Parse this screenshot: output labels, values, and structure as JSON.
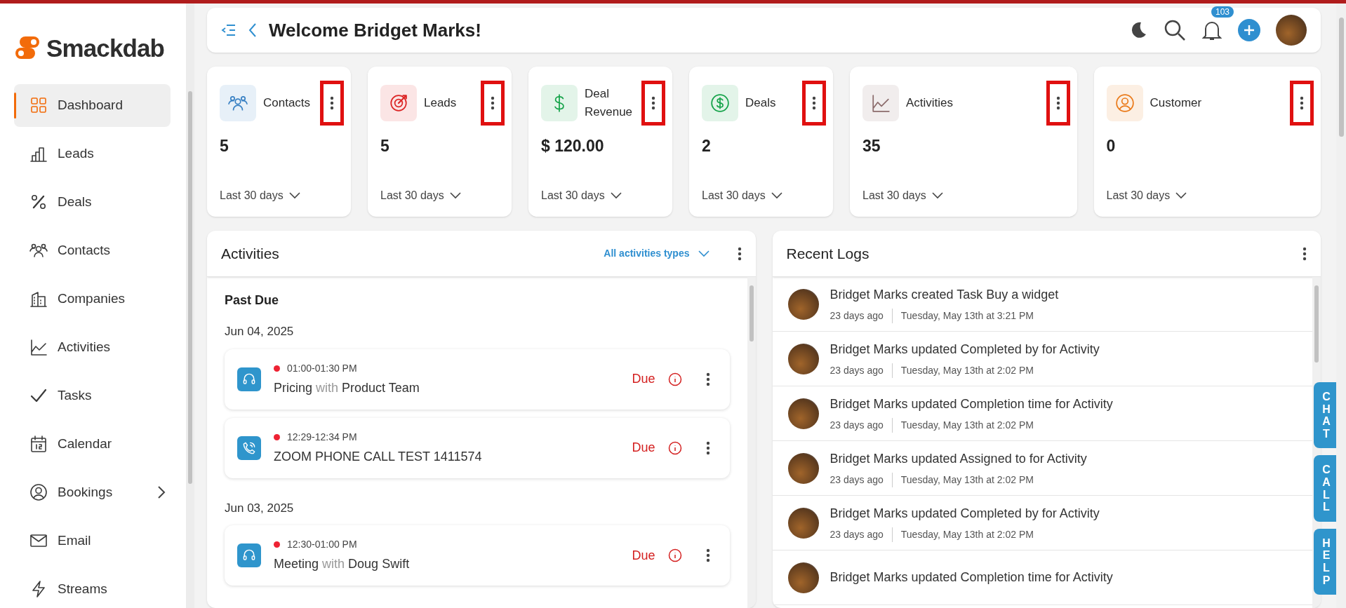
{
  "brand": {
    "name": "Smackdab"
  },
  "sidebar": {
    "items": [
      {
        "label": "Dashboard",
        "selected": true,
        "submenu": false
      },
      {
        "label": "Leads",
        "selected": false,
        "submenu": false
      },
      {
        "label": "Deals",
        "selected": false,
        "submenu": false
      },
      {
        "label": "Contacts",
        "selected": false,
        "submenu": false
      },
      {
        "label": "Companies",
        "selected": false,
        "submenu": false
      },
      {
        "label": "Activities",
        "selected": false,
        "submenu": false
      },
      {
        "label": "Tasks",
        "selected": false,
        "submenu": false
      },
      {
        "label": "Calendar",
        "selected": false,
        "submenu": false
      },
      {
        "label": "Bookings",
        "selected": false,
        "submenu": true
      },
      {
        "label": "Email",
        "selected": false,
        "submenu": false
      },
      {
        "label": "Streams",
        "selected": false,
        "submenu": false
      }
    ]
  },
  "header": {
    "title": "Welcome Bridget Marks!",
    "notifications": "103"
  },
  "stats": [
    {
      "color": "#3b82c4",
      "label": "Contacts",
      "value": "5",
      "period": "Last 30 days",
      "highlighted": true
    },
    {
      "color": "#dc2626",
      "label": "Leads",
      "value": "5",
      "period": "Last 30 days",
      "highlighted": true
    },
    {
      "color": "#16a34a",
      "label": "Deal Revenue",
      "value": "$ 120.00",
      "period": "Last 30 days",
      "highlighted": true
    },
    {
      "color": "#16a34a",
      "label": "Deals",
      "value": "2",
      "period": "Last 30 days",
      "highlighted": true
    },
    {
      "color": "#8b6b6b",
      "label": "Activities",
      "value": "35",
      "period": "Last 30 days",
      "highlighted": true
    },
    {
      "color": "#ea7a1a",
      "label": "Customer",
      "value": "0",
      "period": "Last 30 days",
      "highlighted": true
    }
  ],
  "activities": {
    "title": "Activities",
    "filter": "All activities types",
    "section": "Past Due",
    "groups": [
      {
        "date": "Jun 04, 2025",
        "items": [
          {
            "kind": "meeting",
            "time": "01:00-01:30 PM",
            "subject": "Pricing",
            "connector": "with",
            "contact": "Product Team",
            "status": "Due"
          },
          {
            "kind": "call",
            "time": "12:29-12:34 PM",
            "subject": "ZOOM PHONE CALL TEST 1411574",
            "status": "Due"
          }
        ]
      },
      {
        "date": "Jun 03, 2025",
        "items": [
          {
            "kind": "meeting",
            "time": "12:30-01:00 PM",
            "subject": "Meeting",
            "connector": "with",
            "contact": "Doug Swift",
            "status": "Due"
          }
        ]
      }
    ]
  },
  "logs": {
    "title": "Recent Logs",
    "items": [
      {
        "text": "Bridget Marks created Task Buy a widget",
        "ago": "23 days ago",
        "when": "Tuesday, May 13th at 3:21 PM"
      },
      {
        "text": "Bridget Marks updated Completed by for Activity",
        "ago": "23 days ago",
        "when": "Tuesday, May 13th at 2:02 PM"
      },
      {
        "text": "Bridget Marks updated Completion time for Activity",
        "ago": "23 days ago",
        "when": "Tuesday, May 13th at 2:02 PM"
      },
      {
        "text": "Bridget Marks updated Assigned to for Activity",
        "ago": "23 days ago",
        "when": "Tuesday, May 13th at 2:02 PM"
      },
      {
        "text": "Bridget Marks updated Completed by for Activity",
        "ago": "23 days ago",
        "when": "Tuesday, May 13th at 2:02 PM"
      },
      {
        "text": "Bridget Marks updated Completion time for Activity"
      }
    ]
  },
  "side_tabs": [
    "CHAT",
    "CALL",
    "HELP"
  ]
}
